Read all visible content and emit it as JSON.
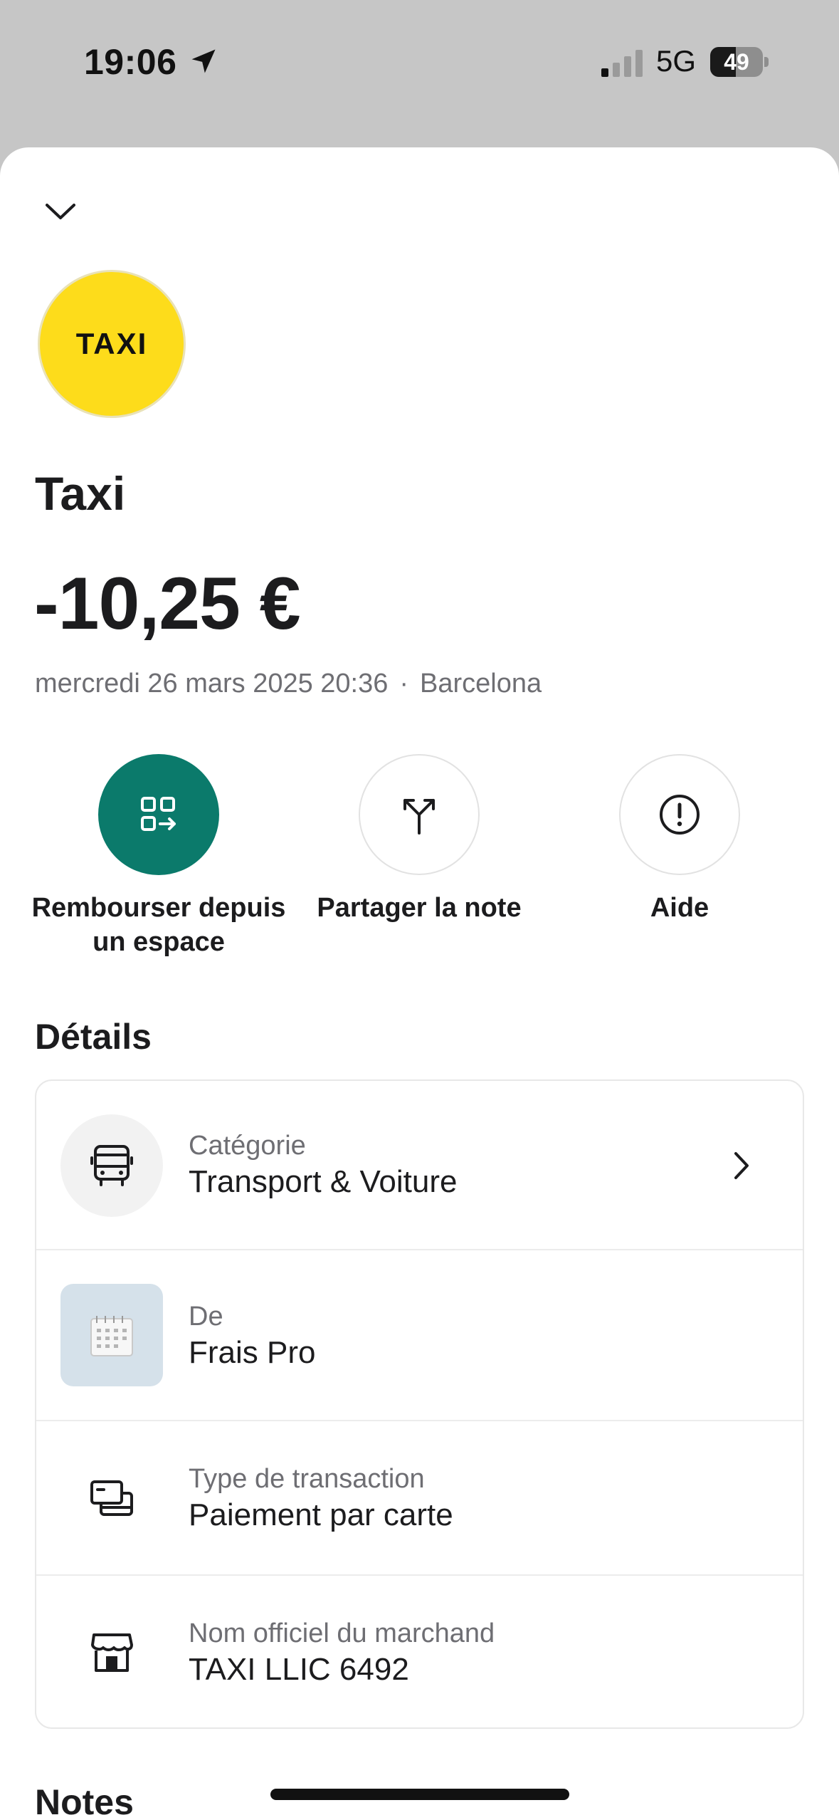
{
  "status_bar": {
    "time": "19:06",
    "network": "5G",
    "battery_level": "49",
    "battery_fraction": 0.49
  },
  "merchant": {
    "logo_text": "TAXI",
    "name": "Taxi",
    "logo_color": "#fddc1b"
  },
  "transaction": {
    "amount": "-10,25 €",
    "date": "mercredi 26 mars 2025 20:36",
    "separator": "·",
    "location": "Barcelona"
  },
  "actions": [
    {
      "label": "Rembourser depuis un espace",
      "icon": "reimburse-icon",
      "color": "#0b7a6b"
    },
    {
      "label": "Partager la note",
      "icon": "split-icon"
    },
    {
      "label": "Aide",
      "icon": "help-icon"
    }
  ],
  "details": {
    "title": "Détails",
    "rows": [
      {
        "label": "Catégorie",
        "value": "Transport & Voiture",
        "icon": "bus-icon"
      },
      {
        "label": "De",
        "value": "Frais Pro",
        "icon": "calendar-icon"
      },
      {
        "label": "Type de transaction",
        "value": "Paiement par carte",
        "icon": "cards-icon"
      },
      {
        "label": "Nom officiel du marchand",
        "value": "TAXI LLIC 6492",
        "icon": "store-icon"
      }
    ]
  },
  "notes": {
    "title": "Notes"
  }
}
